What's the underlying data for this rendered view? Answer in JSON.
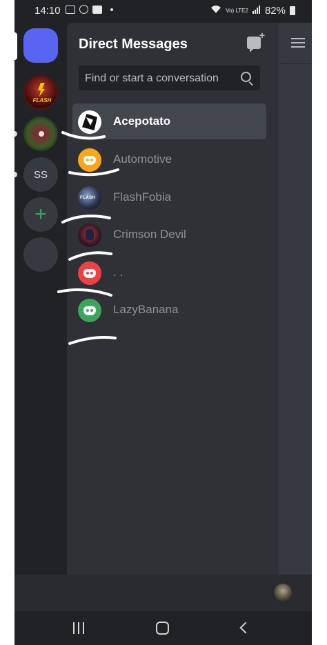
{
  "status_bar": {
    "time": "14:10",
    "network_label": "Vo) LTE2",
    "battery_percent": "82%"
  },
  "servers": [
    {
      "name": "home",
      "icon": "discord-home"
    },
    {
      "name": "flash-server",
      "icon": "flash-logo",
      "text": "FLASH"
    },
    {
      "name": "picture-server",
      "icon": "server-picture"
    },
    {
      "name": "ss-server",
      "initials": "SS"
    },
    {
      "name": "add-server",
      "glyph": "+"
    },
    {
      "name": "empty-server"
    }
  ],
  "dm_panel": {
    "title": "Direct Messages",
    "search_placeholder": "Find or start a conversation",
    "conversations": [
      {
        "name": "Acepotato",
        "active": true,
        "avatar": "acepotato-avatar"
      },
      {
        "name": "Automotive",
        "active": false,
        "avatar": "discord-default",
        "color": "#faa61a"
      },
      {
        "name": "FlashFobia",
        "active": false,
        "avatar": "flashfobia-avatar",
        "avatar_text": "FLASH"
      },
      {
        "name": "Crimson Devil",
        "active": false,
        "avatar": "crimson-devil-avatar"
      },
      {
        "name": ". .",
        "active": false,
        "avatar": "discord-default",
        "color": "#ed4245"
      },
      {
        "name": "LazyBanana",
        "active": false,
        "avatar": "discord-default",
        "color": "#3ba55c"
      }
    ]
  },
  "colors": {
    "blurple": "#5865f2",
    "background": "#202225",
    "panel": "#2f3136",
    "active_item": "#42464d",
    "add_green": "#3ba55c"
  },
  "icons": [
    "new-dm-icon",
    "search-icon",
    "hamburger-icon",
    "recents-icon",
    "home-icon",
    "back-icon"
  ]
}
